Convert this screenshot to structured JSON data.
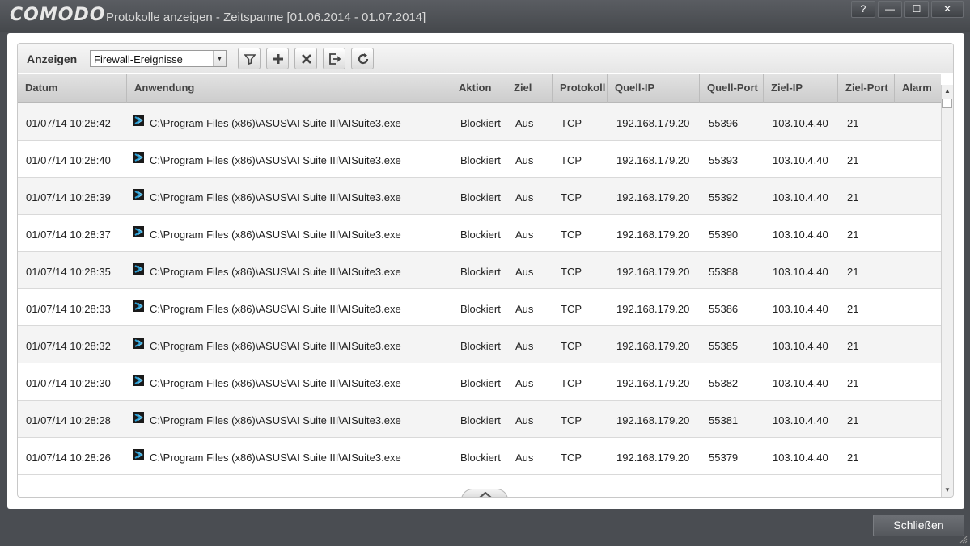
{
  "window": {
    "logo": "COMODO",
    "title": "Protokolle anzeigen - Zeitspanne [01.06.2014 - 01.07.2014]",
    "buttons": {
      "help": "?",
      "minimize": "—",
      "maximize": "☐",
      "close": "✕"
    }
  },
  "toolbar": {
    "label": "Anzeigen",
    "selected_view": "Firewall-Ereignisse",
    "icons": [
      "filter-icon",
      "add-icon",
      "delete-icon",
      "export-icon",
      "refresh-icon"
    ]
  },
  "table": {
    "columns": [
      "Datum",
      "Anwendung",
      "Aktion",
      "Ziel",
      "Protokoll",
      "Quell-IP",
      "Quell-Port",
      "Ziel-IP",
      "Ziel-Port",
      "Alarm"
    ],
    "rows": [
      {
        "datum": "01/07/14 10:28:42",
        "anwendung": "C:\\Program Files (x86)\\ASUS\\AI Suite III\\AISuite3.exe",
        "aktion": "Blockiert",
        "ziel": "Aus",
        "protokoll": "TCP",
        "quell_ip": "192.168.179.20",
        "quell_port": "55396",
        "ziel_ip": "103.10.4.40",
        "ziel_port": "21",
        "alarm": ""
      },
      {
        "datum": "01/07/14 10:28:40",
        "anwendung": "C:\\Program Files (x86)\\ASUS\\AI Suite III\\AISuite3.exe",
        "aktion": "Blockiert",
        "ziel": "Aus",
        "protokoll": "TCP",
        "quell_ip": "192.168.179.20",
        "quell_port": "55393",
        "ziel_ip": "103.10.4.40",
        "ziel_port": "21",
        "alarm": ""
      },
      {
        "datum": "01/07/14 10:28:39",
        "anwendung": "C:\\Program Files (x86)\\ASUS\\AI Suite III\\AISuite3.exe",
        "aktion": "Blockiert",
        "ziel": "Aus",
        "protokoll": "TCP",
        "quell_ip": "192.168.179.20",
        "quell_port": "55392",
        "ziel_ip": "103.10.4.40",
        "ziel_port": "21",
        "alarm": ""
      },
      {
        "datum": "01/07/14 10:28:37",
        "anwendung": "C:\\Program Files (x86)\\ASUS\\AI Suite III\\AISuite3.exe",
        "aktion": "Blockiert",
        "ziel": "Aus",
        "protokoll": "TCP",
        "quell_ip": "192.168.179.20",
        "quell_port": "55390",
        "ziel_ip": "103.10.4.40",
        "ziel_port": "21",
        "alarm": ""
      },
      {
        "datum": "01/07/14 10:28:35",
        "anwendung": "C:\\Program Files (x86)\\ASUS\\AI Suite III\\AISuite3.exe",
        "aktion": "Blockiert",
        "ziel": "Aus",
        "protokoll": "TCP",
        "quell_ip": "192.168.179.20",
        "quell_port": "55388",
        "ziel_ip": "103.10.4.40",
        "ziel_port": "21",
        "alarm": ""
      },
      {
        "datum": "01/07/14 10:28:33",
        "anwendung": "C:\\Program Files (x86)\\ASUS\\AI Suite III\\AISuite3.exe",
        "aktion": "Blockiert",
        "ziel": "Aus",
        "protokoll": "TCP",
        "quell_ip": "192.168.179.20",
        "quell_port": "55386",
        "ziel_ip": "103.10.4.40",
        "ziel_port": "21",
        "alarm": ""
      },
      {
        "datum": "01/07/14 10:28:32",
        "anwendung": "C:\\Program Files (x86)\\ASUS\\AI Suite III\\AISuite3.exe",
        "aktion": "Blockiert",
        "ziel": "Aus",
        "protokoll": "TCP",
        "quell_ip": "192.168.179.20",
        "quell_port": "55385",
        "ziel_ip": "103.10.4.40",
        "ziel_port": "21",
        "alarm": ""
      },
      {
        "datum": "01/07/14 10:28:30",
        "anwendung": "C:\\Program Files (x86)\\ASUS\\AI Suite III\\AISuite3.exe",
        "aktion": "Blockiert",
        "ziel": "Aus",
        "protokoll": "TCP",
        "quell_ip": "192.168.179.20",
        "quell_port": "55382",
        "ziel_ip": "103.10.4.40",
        "ziel_port": "21",
        "alarm": ""
      },
      {
        "datum": "01/07/14 10:28:28",
        "anwendung": "C:\\Program Files (x86)\\ASUS\\AI Suite III\\AISuite3.exe",
        "aktion": "Blockiert",
        "ziel": "Aus",
        "protokoll": "TCP",
        "quell_ip": "192.168.179.20",
        "quell_port": "55381",
        "ziel_ip": "103.10.4.40",
        "ziel_port": "21",
        "alarm": ""
      },
      {
        "datum": "01/07/14 10:28:26",
        "anwendung": "C:\\Program Files (x86)\\ASUS\\AI Suite III\\AISuite3.exe",
        "aktion": "Blockiert",
        "ziel": "Aus",
        "protokoll": "TCP",
        "quell_ip": "192.168.179.20",
        "quell_port": "55379",
        "ziel_ip": "103.10.4.40",
        "ziel_port": "21",
        "alarm": ""
      }
    ]
  },
  "footer": {
    "close_label": "Schließen"
  },
  "colors": {
    "frame": "#4a4d52",
    "header": "#d6d6d6",
    "row_alt": "#f4f4f4",
    "icon_blue": "#2a9fd6"
  }
}
